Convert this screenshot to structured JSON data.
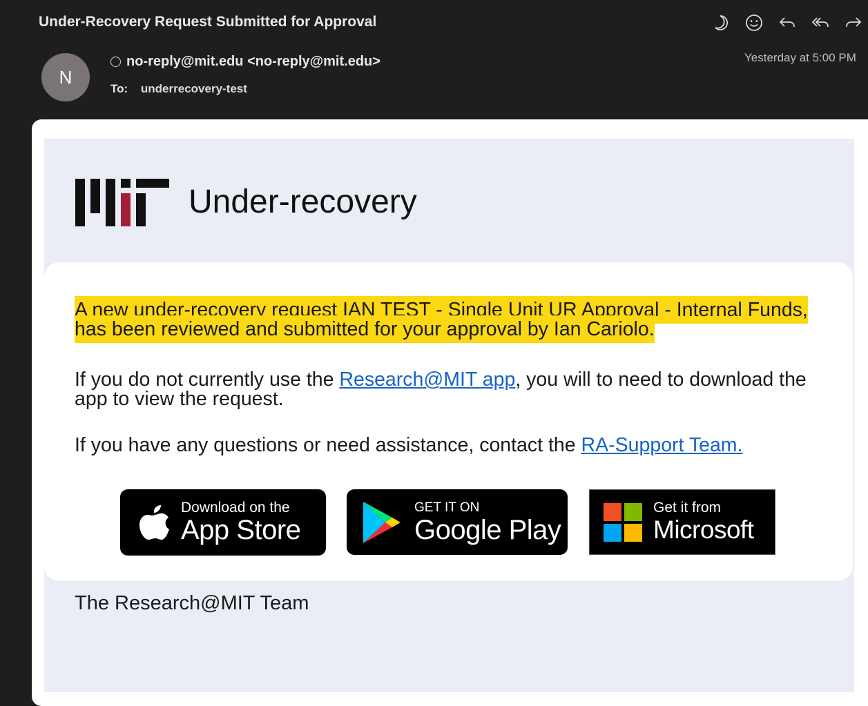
{
  "message": {
    "subject": "Under-Recovery Request Submitted for Approval",
    "sender_initial": "N",
    "from": "no-reply@mit.edu <no-reply@mit.edu>",
    "to_label": "To:",
    "to": "underrecovery-test",
    "date": "Yesterday at 5:00 PM"
  },
  "toolbar": {
    "icons": [
      "moon-icon",
      "smiley-icon",
      "reply-icon",
      "reply-all-icon",
      "forward-icon"
    ]
  },
  "email": {
    "brand_name": "Under-recovery",
    "highlight_text": "A new under-recovery request IAN TEST - Single Unit UR Approval - Internal Funds, has been reviewed and submitted for your approval by Ian Cariolo.",
    "p2_before": "If you do not currently use the ",
    "p2_link": "Research@MIT app",
    "p2_after": ", you will to need to download the app to view the request.",
    "p3_before": "If you have any questions or need assistance, contact the ",
    "p3_link": "RA-Support Team.",
    "signature": "The Research@MIT Team"
  },
  "badges": {
    "apple_small": "Download on the",
    "apple_big": "App Store",
    "google_small": "GET IT ON",
    "google_big": "Google Play",
    "ms_small": "Get it from",
    "ms_big": "Microsoft"
  },
  "colors": {
    "highlight": "#fbd812",
    "link": "#1763c4",
    "mit_red": "#a31f34"
  }
}
